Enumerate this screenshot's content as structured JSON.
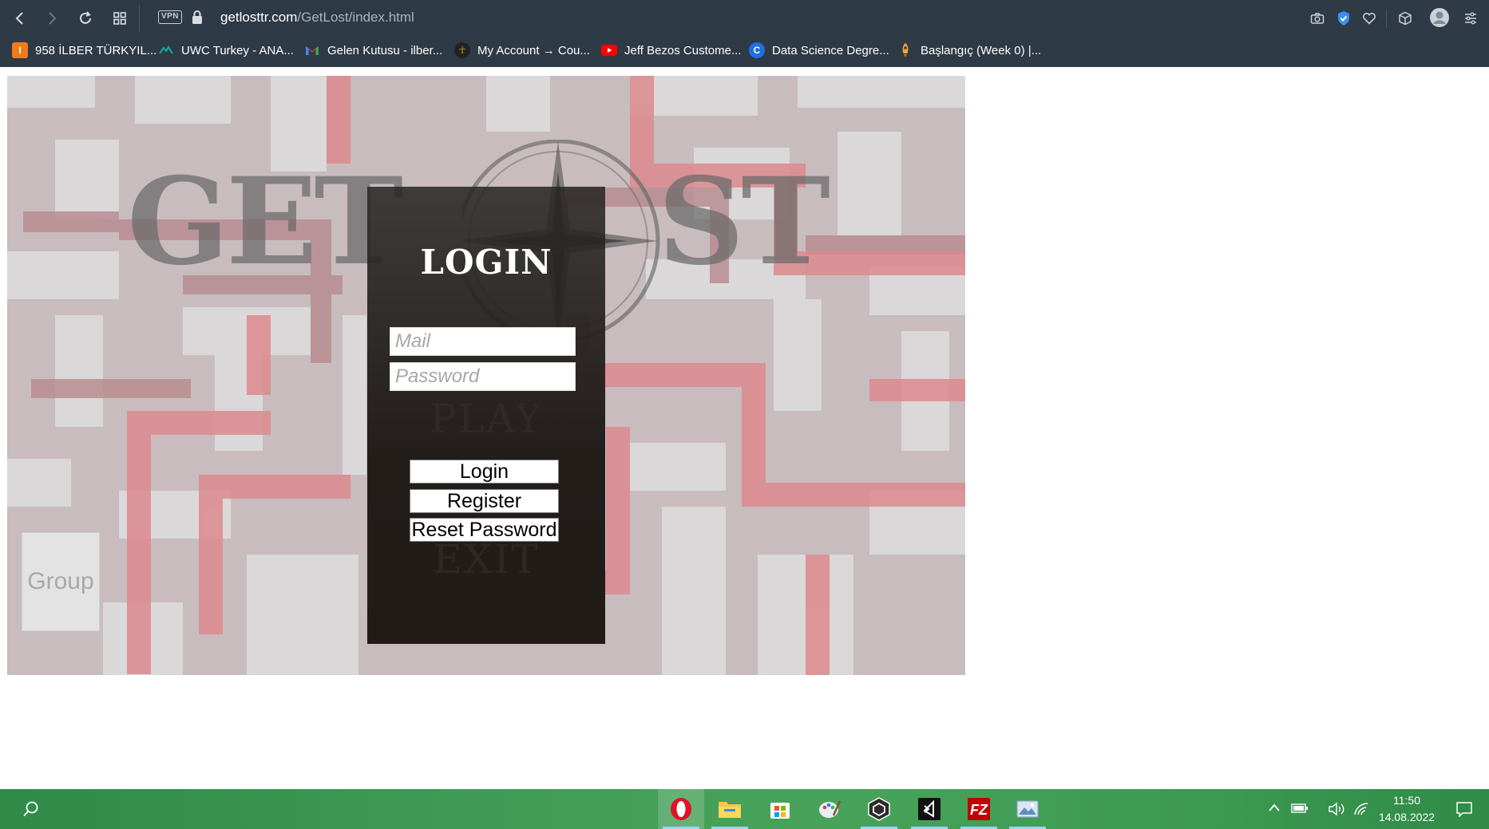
{
  "browser": {
    "url_host": "getlosttr.com",
    "url_path": "/GetLost/index.html",
    "vpn_label": "VPN",
    "bookmarks": [
      {
        "label": "958 İLBER TÜRKYIL...",
        "icon": "bookmark-favicon-orange",
        "color": "#f07a1c"
      },
      {
        "label": "UWC Turkey - ANA...",
        "icon": "bookmark-favicon-uwc",
        "color": "#1aa3a3"
      },
      {
        "label": "Gelen Kutusu - ilber...",
        "icon": "gmail-icon",
        "color": "#ea4335"
      },
      {
        "label": "My Account → Cou...",
        "icon": "bookmark-favicon-account",
        "color": "#c9a227"
      },
      {
        "label": "Jeff Bezos Custome...",
        "icon": "youtube-icon",
        "color": "#ff0000"
      },
      {
        "label": "Data Science Degre...",
        "icon": "coursera-icon",
        "color": "#1f6fe5"
      },
      {
        "label": "Başlangıç (Week 0) |...",
        "icon": "bookmark-favicon-rocket",
        "color": "#f2a33a"
      }
    ]
  },
  "game": {
    "title_left": "GET",
    "title_right": "ST",
    "panel_title": "LOGIN",
    "ghost_play": "PLAY",
    "ghost_exit": "EXIT",
    "mail_placeholder": "Mail",
    "password_placeholder": "Password",
    "login_label": "Login",
    "register_label": "Register",
    "reset_label": "Reset Password",
    "group_label": "Group"
  },
  "taskbar": {
    "time": "11:50",
    "date": "14.08.2022",
    "apps": [
      "opera-icon",
      "file-explorer-icon",
      "microsoft-store-icon",
      "paint-icon",
      "unity-icon",
      "visual-studio-icon",
      "filezilla-icon",
      "photos-icon"
    ]
  },
  "colors": {
    "topbar": "#2e3a46",
    "panel": "#231d1a",
    "taskbar": "#3f9a55"
  }
}
